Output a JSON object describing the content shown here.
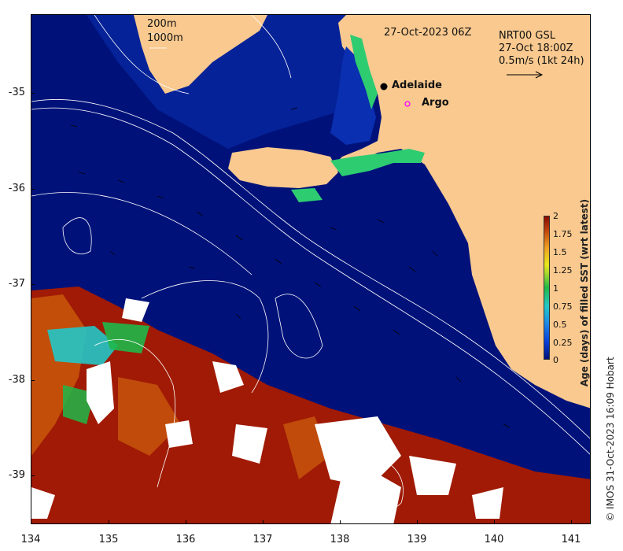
{
  "map": {
    "date_label": "27-Oct-2023 06Z",
    "current_info": {
      "line1": "NRT00 GSL",
      "line2": "27-Oct 18:00Z",
      "line3": "0.5m/s (1kt 24h)"
    },
    "isobath_legend": [
      "200m",
      "1000m"
    ],
    "places": [
      {
        "name": "Adelaide",
        "marker": "filled-dot"
      },
      {
        "name": "Argo",
        "marker": "magenta-ring"
      }
    ],
    "x_ticks": [
      "134",
      "135",
      "136",
      "137",
      "138",
      "139",
      "140",
      "141"
    ],
    "y_ticks": [
      "-35",
      "-36",
      "-37",
      "-38",
      "-39"
    ],
    "colorbar": {
      "title": "Age (days) of filled SST (wrt latest)",
      "ticks": [
        "0",
        "0.25",
        "0.5",
        "0.75",
        "1",
        "1.25",
        "1.5",
        "1.75",
        "2"
      ]
    },
    "credit": "© IMOS 31-Oct-2023 16:09 Hobart",
    "colors": {
      "land": "#f9c98f",
      "ocean_fresh": "#00127a",
      "ocean_old": "#a01a05",
      "coast_young": "#2ecc71",
      "no_data": "#ffffff"
    }
  }
}
